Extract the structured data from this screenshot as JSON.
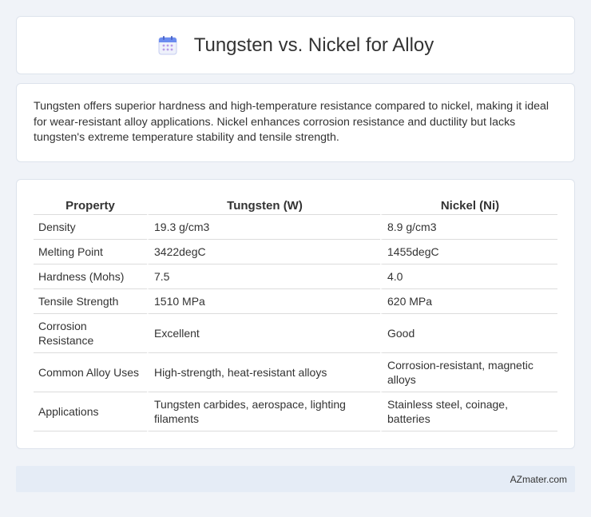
{
  "header": {
    "icon": "calendar-icon",
    "title": "Tungsten vs. Nickel for Alloy"
  },
  "summary": {
    "text": "Tungsten offers superior hardness and high-temperature resistance compared to nickel, making it ideal for wear-resistant alloy applications. Nickel enhances corrosion resistance and ductility but lacks tungsten's extreme temperature stability and tensile strength."
  },
  "table": {
    "headers": [
      "Property",
      "Tungsten (W)",
      "Nickel (Ni)"
    ],
    "rows": [
      [
        "Density",
        "19.3 g/cm3",
        "8.9 g/cm3"
      ],
      [
        "Melting Point",
        "3422degC",
        "1455degC"
      ],
      [
        "Hardness (Mohs)",
        "7.5",
        "4.0"
      ],
      [
        "Tensile Strength",
        "1510 MPa",
        "620 MPa"
      ],
      [
        "Corrosion Resistance",
        "Excellent",
        "Good"
      ],
      [
        "Common Alloy Uses",
        "High-strength, heat-resistant alloys",
        "Corrosion-resistant, magnetic alloys"
      ],
      [
        "Applications",
        "Tungsten carbides, aerospace, lighting filaments",
        "Stainless steel, coinage, batteries"
      ]
    ]
  },
  "footer": {
    "text": "AZmater.com"
  },
  "colors": {
    "background": "#f0f3f8",
    "card": "#ffffff",
    "footer": "#e5ecf6",
    "icon_accent": "#6b8cf0"
  }
}
